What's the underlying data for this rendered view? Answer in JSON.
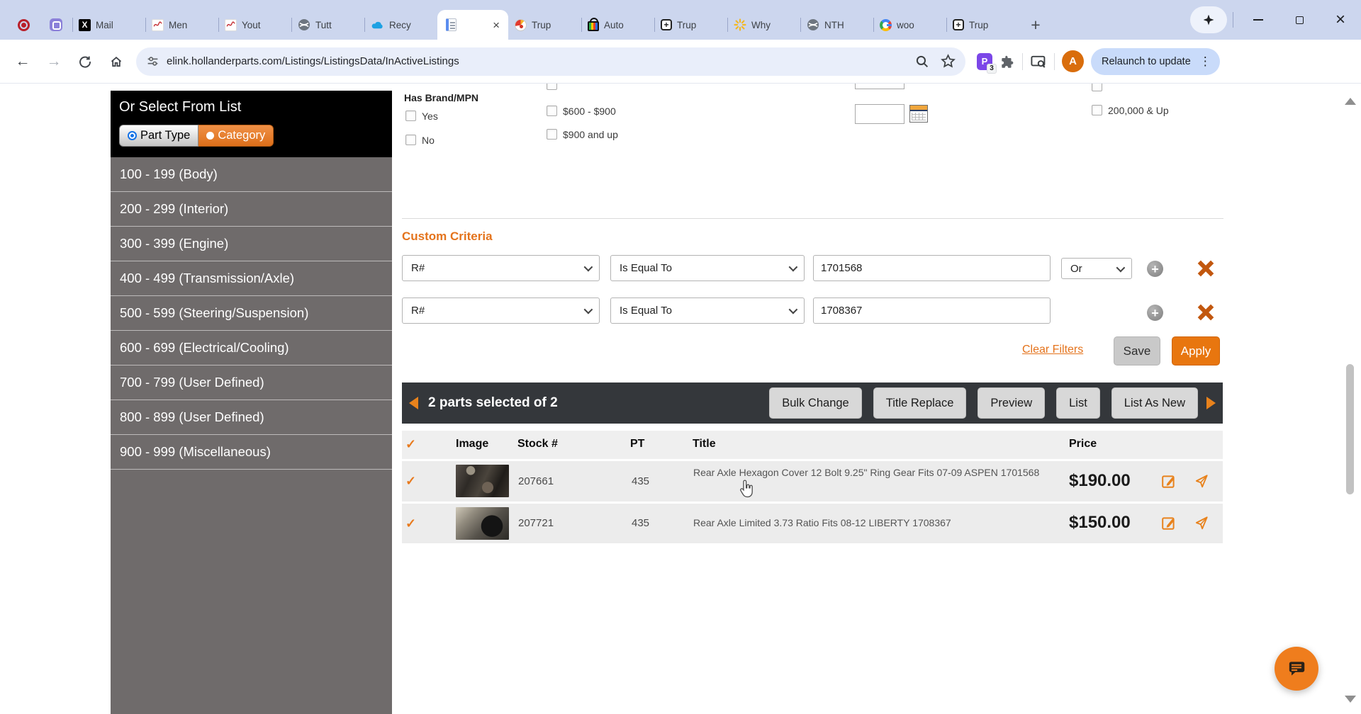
{
  "colors": {
    "accent_orange": "#e8770f",
    "link_orange": "#e4731c",
    "delete_x_orange": "#c2570e",
    "sidebar_gray": "#6f6b6b",
    "dark_bar": "#34373b",
    "tabstrip_bg": "#ccd6ee"
  },
  "icons": {
    "check": "✓"
  },
  "browser": {
    "tabs": [
      {
        "label": "",
        "icon": "record-icon"
      },
      {
        "label": "",
        "icon": "purple-app-icon"
      },
      {
        "label": "Mail",
        "icon": "x-logo-icon"
      },
      {
        "label": "Men",
        "icon": "red-script-icon"
      },
      {
        "label": "Yout",
        "icon": "red-script-icon"
      },
      {
        "label": "Tutt",
        "icon": "globe-icon"
      },
      {
        "label": "Recy",
        "icon": "blue-cloud-icon"
      },
      {
        "label": "",
        "icon": "document-icon",
        "active": true
      },
      {
        "label": "Trup",
        "icon": "red-pie-icon"
      },
      {
        "label": "Auto",
        "icon": "shopping-bag-icon"
      },
      {
        "label": "Trup",
        "icon": "square-plus-icon"
      },
      {
        "label": "Why",
        "icon": "sunburst-icon"
      },
      {
        "label": "NTH",
        "icon": "globe-icon"
      },
      {
        "label": "woo",
        "icon": "google-g-icon"
      },
      {
        "label": "Trup",
        "icon": "square-plus-icon"
      }
    ],
    "new_tab": "+",
    "url": "elink.hollanderparts.com/Listings/ListingsData/InActiveListings",
    "relaunch": "Relaunch to update",
    "avatar": "A",
    "extensions_badge": "3"
  },
  "sidebar": {
    "header": "Or Select From List",
    "toggle": {
      "part_type": "Part Type",
      "category": "Category"
    },
    "items": [
      "100 - 199 (Body)",
      "200 - 299 (Interior)",
      "300 - 399 (Engine)",
      "400 - 499 (Transmission/Axle)",
      "500 - 599 (Steering/Suspension)",
      "600 - 699 (Electrical/Cooling)",
      "700 - 799 (User Defined)",
      "800 - 899 (User Defined)",
      "900 - 999 (Miscellaneous)"
    ]
  },
  "filters": {
    "brand_label": "Has Brand/MPN",
    "brand_yes": "Yes",
    "brand_no": "No",
    "price_options": [
      "$600 - $900",
      "$900 and up"
    ],
    "mileage_option": "200,000 & Up"
  },
  "criteria": {
    "title": "Custom Criteria",
    "rows": [
      {
        "field": "R#",
        "operator": "Is Equal To",
        "value": "1701568",
        "conjunction": "Or"
      },
      {
        "field": "R#",
        "operator": "Is Equal To",
        "value": "1708367",
        "conjunction": ""
      }
    ],
    "clear_label": "Clear Filters",
    "save_label": "Save",
    "apply_label": "Apply"
  },
  "results": {
    "selection_summary": "2 parts selected of 2",
    "actions": [
      "Bulk Change",
      "Title Replace",
      "Preview",
      "List",
      "List As New"
    ],
    "columns": {
      "image": "Image",
      "stock": "Stock #",
      "pt": "PT",
      "title": "Title",
      "price": "Price"
    },
    "rows": [
      {
        "stock": "207661",
        "pt": "435",
        "title": "Rear Axle Hexagon Cover 12 Bolt 9.25\" Ring Gear Fits 07-09 ASPEN 1701568",
        "price": "$190.00"
      },
      {
        "stock": "207721",
        "pt": "435",
        "title": "Rear Axle Limited 3.73 Ratio Fits 08-12 LIBERTY 1708367",
        "price": "$150.00"
      }
    ]
  }
}
